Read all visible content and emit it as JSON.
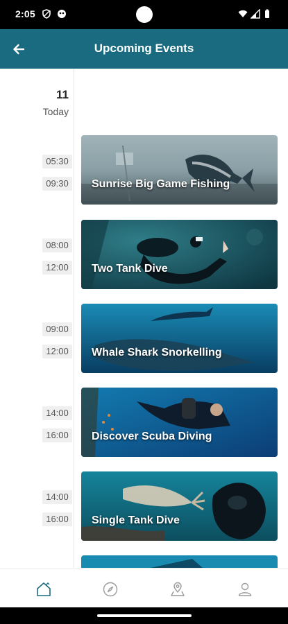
{
  "status_bar": {
    "time": "2:05"
  },
  "app_bar": {
    "title": "Upcoming Events"
  },
  "date": {
    "day": "11",
    "label": "Today"
  },
  "events": [
    {
      "title": "Sunrise Big Game Fishing",
      "start": "05:30",
      "end": "09:30"
    },
    {
      "title": "Two Tank Dive",
      "start": "08:00",
      "end": "12:00"
    },
    {
      "title": "Whale Shark Snorkelling",
      "start": "09:00",
      "end": "12:00"
    },
    {
      "title": "Discover Scuba Diving",
      "start": "14:00",
      "end": "16:00"
    },
    {
      "title": "Single Tank Dive",
      "start": "14:00",
      "end": "16:00"
    }
  ],
  "bottom_nav": [
    {
      "icon": "home-icon",
      "active": true
    },
    {
      "icon": "compass-icon",
      "active": false
    },
    {
      "icon": "map-pin-icon",
      "active": false
    },
    {
      "icon": "profile-icon",
      "active": false
    }
  ],
  "colors": {
    "primary": "#1a6b7f",
    "active_nav": "#1a6b7f",
    "inactive_nav": "#9a9a9a"
  }
}
